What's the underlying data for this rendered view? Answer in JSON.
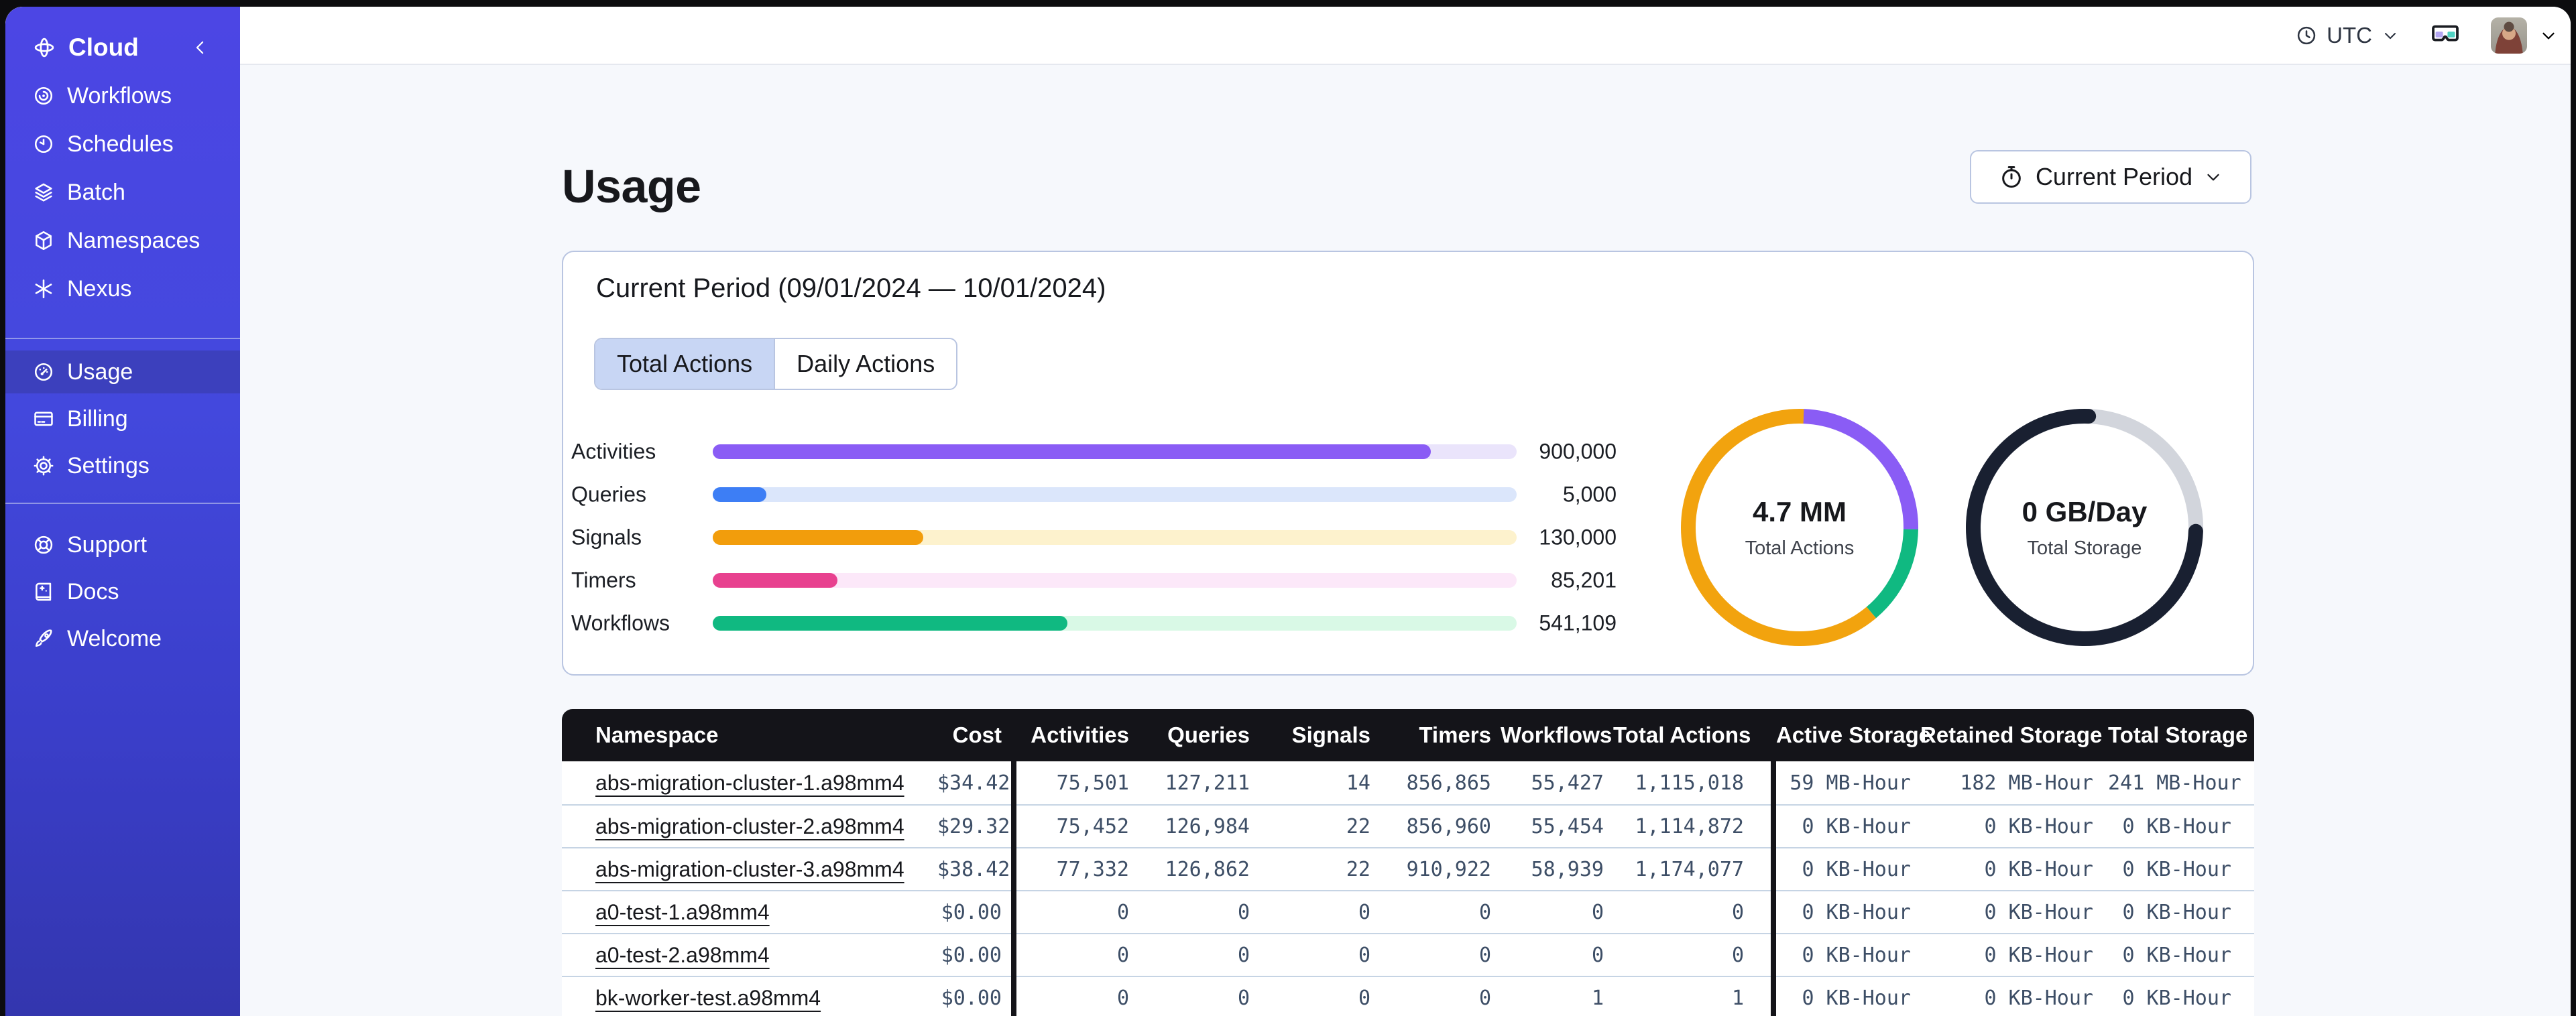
{
  "topbar": {
    "timezone": "UTC"
  },
  "sidebar": {
    "brand": {
      "label": "Cloud",
      "icon": "temporal-cloud-icon",
      "collapse_icon": "chevron-left-icon"
    },
    "sections": [
      {
        "items": [
          {
            "label": "Workflows",
            "icon": "workflows-icon"
          },
          {
            "label": "Schedules",
            "icon": "schedules-icon"
          },
          {
            "label": "Batch",
            "icon": "batch-icon"
          },
          {
            "label": "Namespaces",
            "icon": "namespaces-icon"
          },
          {
            "label": "Nexus",
            "icon": "nexus-icon"
          }
        ]
      },
      {
        "items": [
          {
            "label": "Usage",
            "icon": "usage-icon",
            "active": true
          },
          {
            "label": "Billing",
            "icon": "billing-icon"
          },
          {
            "label": "Settings",
            "icon": "settings-icon"
          }
        ]
      },
      {
        "items": [
          {
            "label": "Support",
            "icon": "support-icon"
          },
          {
            "label": "Docs",
            "icon": "docs-icon"
          },
          {
            "label": "Welcome",
            "icon": "welcome-icon"
          }
        ]
      }
    ]
  },
  "page": {
    "title": "Usage",
    "period_selector_label": "Current Period"
  },
  "usage_card": {
    "title": "Current Period (09/01/2024 — 10/01/2024)",
    "tabs": [
      {
        "label": "Total Actions",
        "active": true
      },
      {
        "label": "Daily Actions",
        "active": false
      }
    ],
    "chart_data": [
      {
        "type": "bar",
        "orientation": "horizontal",
        "categories": [
          "Activities",
          "Queries",
          "Signals",
          "Timers",
          "Workflows"
        ],
        "values": [
          900000,
          5000,
          130000,
          85201,
          541109
        ],
        "value_labels": [
          "900,000",
          "5,000",
          "130,000",
          "85,201",
          "541,109"
        ],
        "bar_fill_fractions": [
          0.893,
          0.067,
          0.262,
          0.155,
          0.441
        ],
        "bar_colors": [
          "#8a5cf5",
          "#3d7ef5",
          "#f29d0c",
          "#e8418f",
          "#10b981"
        ],
        "track_colors": [
          "#eae4fb",
          "#dbe6fb",
          "#fdf2cd",
          "#fce8f9",
          "#d9f9e6"
        ]
      },
      {
        "type": "donut",
        "center_value": "4.7 MM",
        "center_label": "Total Actions",
        "start_angle_deg": -88,
        "linecap": "butt",
        "segments": [
          {
            "name": "purple-segment",
            "color": "#8a5cf5",
            "fraction": 0.247
          },
          {
            "name": "green-segment",
            "color": "#10b981",
            "fraction": 0.136
          },
          {
            "name": "orange-segment",
            "color": "#f2a30e",
            "fraction": 0.617
          }
        ]
      },
      {
        "type": "donut",
        "center_value": "0 GB/Day",
        "center_label": "Total Storage",
        "start_angle_deg": 2,
        "linecap": "round",
        "track_color": "#d2d5dc",
        "segments": [
          {
            "name": "storage-segment",
            "color": "#192031",
            "fraction": 0.75
          }
        ]
      }
    ]
  },
  "table": {
    "columns": [
      "Namespace",
      "Cost",
      "Activities",
      "Queries",
      "Signals",
      "Timers",
      "Workflows",
      "Total Actions",
      "Active Storage",
      "Retained Storage",
      "Total Storage"
    ],
    "rows": [
      {
        "namespace": "abs-migration-cluster-1.a98mm4",
        "cost": "$34.42",
        "activities": "75,501",
        "queries": "127,211",
        "signals": "14",
        "timers": "856,865",
        "workflows": "55,427",
        "total_actions": "1,115,018",
        "active_storage": "59 MB-Hour",
        "retained_storage": "182 MB-Hour",
        "total_storage": "241 MB-Hour"
      },
      {
        "namespace": "abs-migration-cluster-2.a98mm4",
        "cost": "$29.32",
        "activities": "75,452",
        "queries": "126,984",
        "signals": "22",
        "timers": "856,960",
        "workflows": "55,454",
        "total_actions": "1,114,872",
        "active_storage": "0 KB-Hour",
        "retained_storage": "0 KB-Hour",
        "total_storage": "0 KB-Hour"
      },
      {
        "namespace": "abs-migration-cluster-3.a98mm4",
        "cost": "$38.42",
        "activities": "77,332",
        "queries": "126,862",
        "signals": "22",
        "timers": "910,922",
        "workflows": "58,939",
        "total_actions": "1,174,077",
        "active_storage": "0 KB-Hour",
        "retained_storage": "0 KB-Hour",
        "total_storage": "0 KB-Hour"
      },
      {
        "namespace": "a0-test-1.a98mm4",
        "cost": "$0.00",
        "activities": "0",
        "queries": "0",
        "signals": "0",
        "timers": "0",
        "workflows": "0",
        "total_actions": "0",
        "active_storage": "0 KB-Hour",
        "retained_storage": "0 KB-Hour",
        "total_storage": "0 KB-Hour"
      },
      {
        "namespace": "a0-test-2.a98mm4",
        "cost": "$0.00",
        "activities": "0",
        "queries": "0",
        "signals": "0",
        "timers": "0",
        "workflows": "0",
        "total_actions": "0",
        "active_storage": "0 KB-Hour",
        "retained_storage": "0 KB-Hour",
        "total_storage": "0 KB-Hour"
      },
      {
        "namespace": "bk-worker-test.a98mm4",
        "cost": "$0.00",
        "activities": "0",
        "queries": "0",
        "signals": "0",
        "timers": "0",
        "workflows": "1",
        "total_actions": "1",
        "active_storage": "0 KB-Hour",
        "retained_storage": "0 KB-Hour",
        "total_storage": "0 KB-Hour"
      }
    ]
  }
}
